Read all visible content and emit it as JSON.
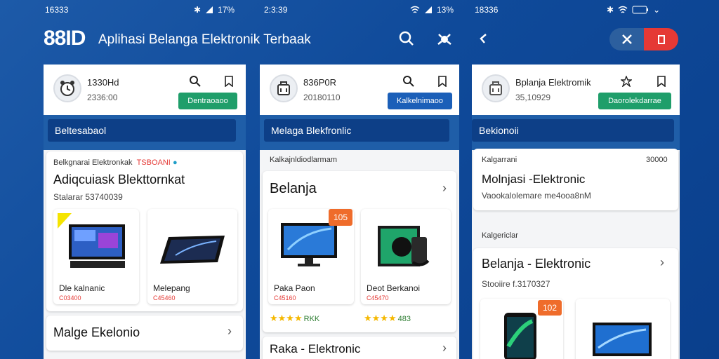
{
  "status_bars": [
    {
      "time": "16333",
      "battery": "17%"
    },
    {
      "time": "2:3:39",
      "battery": "13%"
    },
    {
      "time": "18336",
      "battery": ""
    }
  ],
  "header": {
    "brand": "88ID",
    "title": "Aplihasi Belanga Elektronik Terbaak"
  },
  "panels": [
    {
      "shop_name": "1330Hd",
      "shop_sub": "2336:00",
      "action_label": "Dentraoaoo",
      "band_label": "Beltesabaol",
      "promo": {
        "header": "Belkgnarai Elektronkak",
        "header_tag": "TSBOANI",
        "title": "Adiqcuiask Blekttornkat",
        "subtitle": "Stalarar 53740039"
      },
      "products": [
        {
          "name": "Dle kalnanic",
          "price": "C03400"
        },
        {
          "name": "Melepang",
          "price": "C45460"
        }
      ],
      "bottom_item": "Malge Ekelonio"
    },
    {
      "shop_name": "836P0R",
      "shop_sub": "20180110",
      "action_label": "Kalkelnimaoo",
      "band_label": "Melaga Blekfronlic",
      "section_label": "Kalkajnldiodlarmam",
      "section_title": "Belanja",
      "products": [
        {
          "name": "Paka Paon",
          "price": "C45160",
          "badge": "105",
          "rating": "RKK"
        },
        {
          "name": "Deot Berkanoi",
          "price": "C45470",
          "rating": "483"
        }
      ],
      "bottom_item": "Raka - Elektronic"
    },
    {
      "shop_name": "Bplanja Elektromik",
      "shop_sub": "35,10929",
      "action_label": "Daorolekdarrae",
      "band_label": "Bekionoii",
      "info_card": {
        "label": "Kalgarrani",
        "value": "30000",
        "title": "Molnjasi -Elektronic",
        "subtitle": "Vaookalolemare me4ooa8nM"
      },
      "section_label": "Kalgericlar",
      "section_title": "Belanja - Elektronic",
      "section_sub": "Stooiire f.3170327",
      "products": [
        {
          "badge": "102"
        },
        {}
      ]
    }
  ],
  "colors": {
    "accent_blue": "#0d3f87",
    "green_button": "#1f9e6a",
    "blue_button": "#1b5fb8",
    "red": "#e53935",
    "orange": "#ef6c2b"
  },
  "icons": [
    "search-icon",
    "bug-icon",
    "back-icon",
    "bookmark-icon",
    "star-outline-icon",
    "wifi-icon",
    "signal-icon",
    "bluetooth-icon"
  ]
}
